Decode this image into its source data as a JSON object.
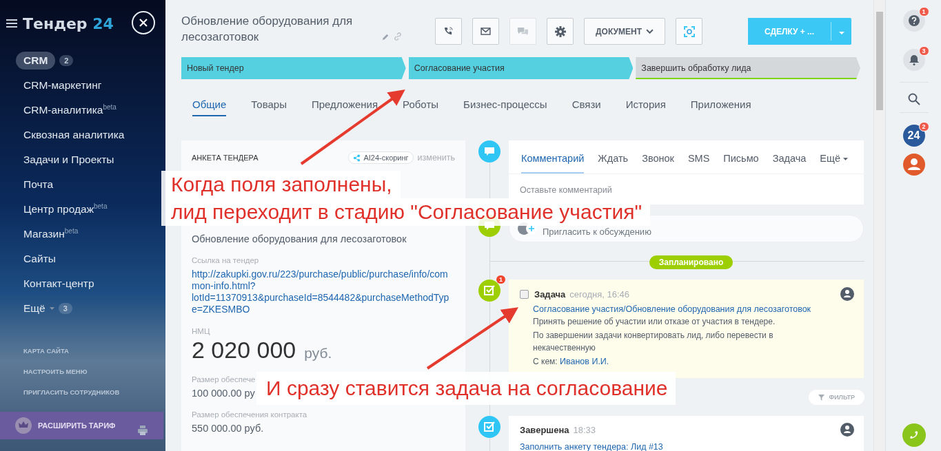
{
  "sidebar": {
    "logo_text": "Тендер",
    "logo_number": "24",
    "items": [
      {
        "label": "CRM",
        "badge": "2",
        "selected": true,
        "has_menu": false
      },
      {
        "label": "CRM-маркетинг",
        "selected": false,
        "has_menu": false
      },
      {
        "label": "CRM-аналитика",
        "sup": "beta",
        "selected": false,
        "has_menu": false
      },
      {
        "label": "Сквозная аналитика",
        "selected": false,
        "has_menu": false
      },
      {
        "label": "Задачи и Проекты",
        "selected": false,
        "has_menu": false
      },
      {
        "label": "Почта",
        "selected": false,
        "has_menu": false
      },
      {
        "label": "Центр продаж",
        "sup": "beta",
        "selected": false,
        "has_menu": false
      },
      {
        "label": "Магазин",
        "sup": "beta",
        "selected": false,
        "has_menu": false
      },
      {
        "label": "Сайты",
        "selected": false,
        "has_menu": false
      },
      {
        "label": "Контакт-центр",
        "selected": false,
        "has_menu": false
      },
      {
        "label": "Ещё",
        "badge": "3",
        "selected": false,
        "has_menu": true
      }
    ],
    "links": [
      "КАРТА САЙТА",
      "НАСТРОИТЬ МЕНЮ",
      "ПРИГЛАСИТЬ СОТРУДНИКОВ"
    ],
    "upgrade_button": "РАСШИРИТЬ ТАРИФ"
  },
  "header": {
    "title": "Обновление оборудования для лесозаготовок",
    "tool_buttons": [
      {
        "kind": "phone",
        "disabled": false
      },
      {
        "kind": "mail",
        "disabled": false
      },
      {
        "kind": "chat",
        "disabled": true
      },
      {
        "kind": "settings",
        "disabled": false
      }
    ],
    "document_button": "ДОКУМЕНТ",
    "primary_button": "СДЕЛКУ + ..."
  },
  "stages": [
    {
      "label": "Новый тендер",
      "reached": true
    },
    {
      "label": "Согласование участия",
      "reached": true
    },
    {
      "label": "Завершить обработку лида",
      "reached": false
    }
  ],
  "tabs": [
    {
      "label": "Общие",
      "selected": true
    },
    {
      "label": "Товары",
      "selected": false
    },
    {
      "label": "Предложения",
      "selected": false
    },
    {
      "label": "Роботы",
      "selected": false
    },
    {
      "label": "Бизнес-процессы",
      "selected": false
    },
    {
      "label": "Связи",
      "selected": false
    },
    {
      "label": "История",
      "selected": false
    },
    {
      "label": "Приложения",
      "selected": false
    }
  ],
  "form": {
    "title": "АНКЕТА ТЕНДЕРА",
    "scoring": "AI24-скоринг",
    "edit_link": "изменить",
    "fields": [
      {
        "kind": "text",
        "value": "Обновление оборудования для лесозаготовок"
      },
      {
        "kind": "link",
        "label": "Ссылка на тендер",
        "value": "http://zakupki.gov.ru/223/purchase/public/purchase/info/common-info.html?lotId=11370913&purchaseId=8544482&purchaseMethodType=ZKESMBO"
      },
      {
        "kind": "price",
        "label": "НМЦ",
        "value": "2 020 000",
        "currency": "руб."
      },
      {
        "kind": "text",
        "label": "Размер обеспече",
        "value": "100 000.00 ру"
      },
      {
        "kind": "text",
        "label": "Размер обеспечения контракта",
        "value": "550 000.00 руб."
      }
    ]
  },
  "timeline": {
    "composer_tabs": [
      {
        "label": "Комментарий",
        "selected": true,
        "has_menu": false
      },
      {
        "label": "Ждать",
        "selected": false,
        "has_menu": false
      },
      {
        "label": "Звонок",
        "selected": false,
        "has_menu": false
      },
      {
        "label": "SMS",
        "selected": false,
        "has_menu": false
      },
      {
        "label": "Письмо",
        "selected": false,
        "has_menu": false
      },
      {
        "label": "Задача",
        "selected": false,
        "has_menu": false
      },
      {
        "label": "Ещё",
        "selected": false,
        "has_menu": true
      }
    ],
    "comment_placeholder": "Оставьте комментарий",
    "invite_placeholder": "Пригласить к обсуждению",
    "planned_label": "Запланировано",
    "task": {
      "title": "Задача",
      "time": "сегодня, 16:46",
      "checked": false,
      "badge": "1",
      "link": "Согласование участия/Обновление оборудования для лесозаготовок",
      "description": [
        "Принять решение об участии или отказе от участия в тендере.",
        "По завершении задачи конвертировать лид, либо перевести в некачественную"
      ],
      "with_label": "С кем:",
      "with_name": "Иванов И.И."
    },
    "filter_button": "ФИЛЬТР",
    "done": {
      "title": "Завершена",
      "time": "18:33",
      "link": "Заполнить анкету тендера: Лид #13"
    }
  },
  "right_bar": {
    "help_badge": "1",
    "bell_badge": "3",
    "app_label": "24",
    "app_badge": "2"
  },
  "annotations": [
    {
      "lines": [
        "Когда поля заполнены,",
        "лид переходит в стадию \"Согласование участия\""
      ]
    },
    {
      "lines": [
        "И сразу ставится задача на согласование"
      ]
    }
  ]
}
